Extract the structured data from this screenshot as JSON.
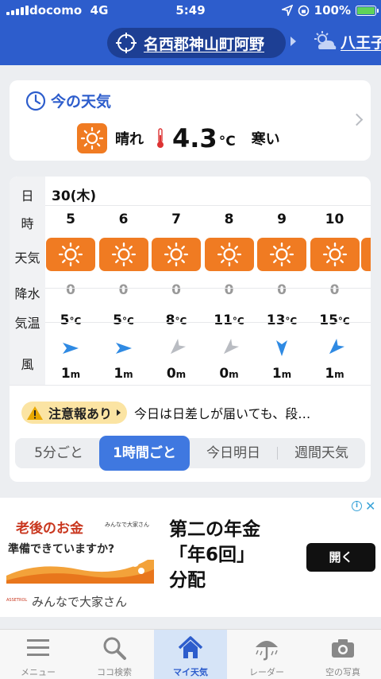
{
  "status_bar": {
    "carrier": "docomo",
    "network": "4G",
    "time": "5:49",
    "battery": "100%"
  },
  "header": {
    "location": "名西郡神山町阿野",
    "next_location": "八王子"
  },
  "now": {
    "title": "今の天気",
    "condition": "晴れ",
    "temp": "4.3",
    "unit": "°C",
    "feel": "寒い"
  },
  "forecast": {
    "labels": {
      "day": "日",
      "hour": "時",
      "weather": "天気",
      "rain": "降水",
      "temp": "気温",
      "wind": "風"
    },
    "date": "30(木)",
    "hours": [
      {
        "hour": "5",
        "rain": "0",
        "temp": "5",
        "wind_speed": "1",
        "wind_dir": "east",
        "wind_color": "#2f8ae3"
      },
      {
        "hour": "6",
        "rain": "0",
        "temp": "5",
        "wind_speed": "1",
        "wind_dir": "east",
        "wind_color": "#2f8ae3"
      },
      {
        "hour": "7",
        "rain": "0",
        "temp": "8",
        "wind_speed": "0",
        "wind_dir": "southwest",
        "wind_color": "#b9bcc2"
      },
      {
        "hour": "8",
        "rain": "0",
        "temp": "11",
        "wind_speed": "0",
        "wind_dir": "southwest",
        "wind_color": "#b9bcc2"
      },
      {
        "hour": "9",
        "rain": "0",
        "temp": "13",
        "wind_speed": "1",
        "wind_dir": "south",
        "wind_color": "#2f8ae3"
      },
      {
        "hour": "10",
        "rain": "0",
        "temp": "15",
        "wind_speed": "1",
        "wind_dir": "southwest",
        "wind_color": "#2f8ae3"
      }
    ],
    "temp_unit": "°C",
    "wind_unit": "m",
    "warning": {
      "label": "注意報あり",
      "text": "今日は日差しが届いても、段…"
    },
    "tabs": [
      "5分ごと",
      "1時間ごと",
      "今日明日",
      "週間天気"
    ],
    "active_tab": "1時間ごと"
  },
  "ad": {
    "headline": "老後のお金",
    "brand_small": "みんなで大家さん",
    "subline": "準備できていますか?",
    "logo_small": "ASSETROL",
    "brand": "みんなで大家さん",
    "title": "第二の年金「年6回」分配",
    "button": "開く"
  },
  "nav": {
    "items": [
      {
        "label": "メニュー",
        "icon": "menu-icon"
      },
      {
        "label": "ココ検索",
        "icon": "search-icon"
      },
      {
        "label": "マイ天気",
        "icon": "home-icon"
      },
      {
        "label": "レーダー",
        "icon": "radar-umbrella-icon"
      },
      {
        "label": "空の写真",
        "icon": "camera-icon"
      }
    ],
    "active": "マイ天気"
  }
}
